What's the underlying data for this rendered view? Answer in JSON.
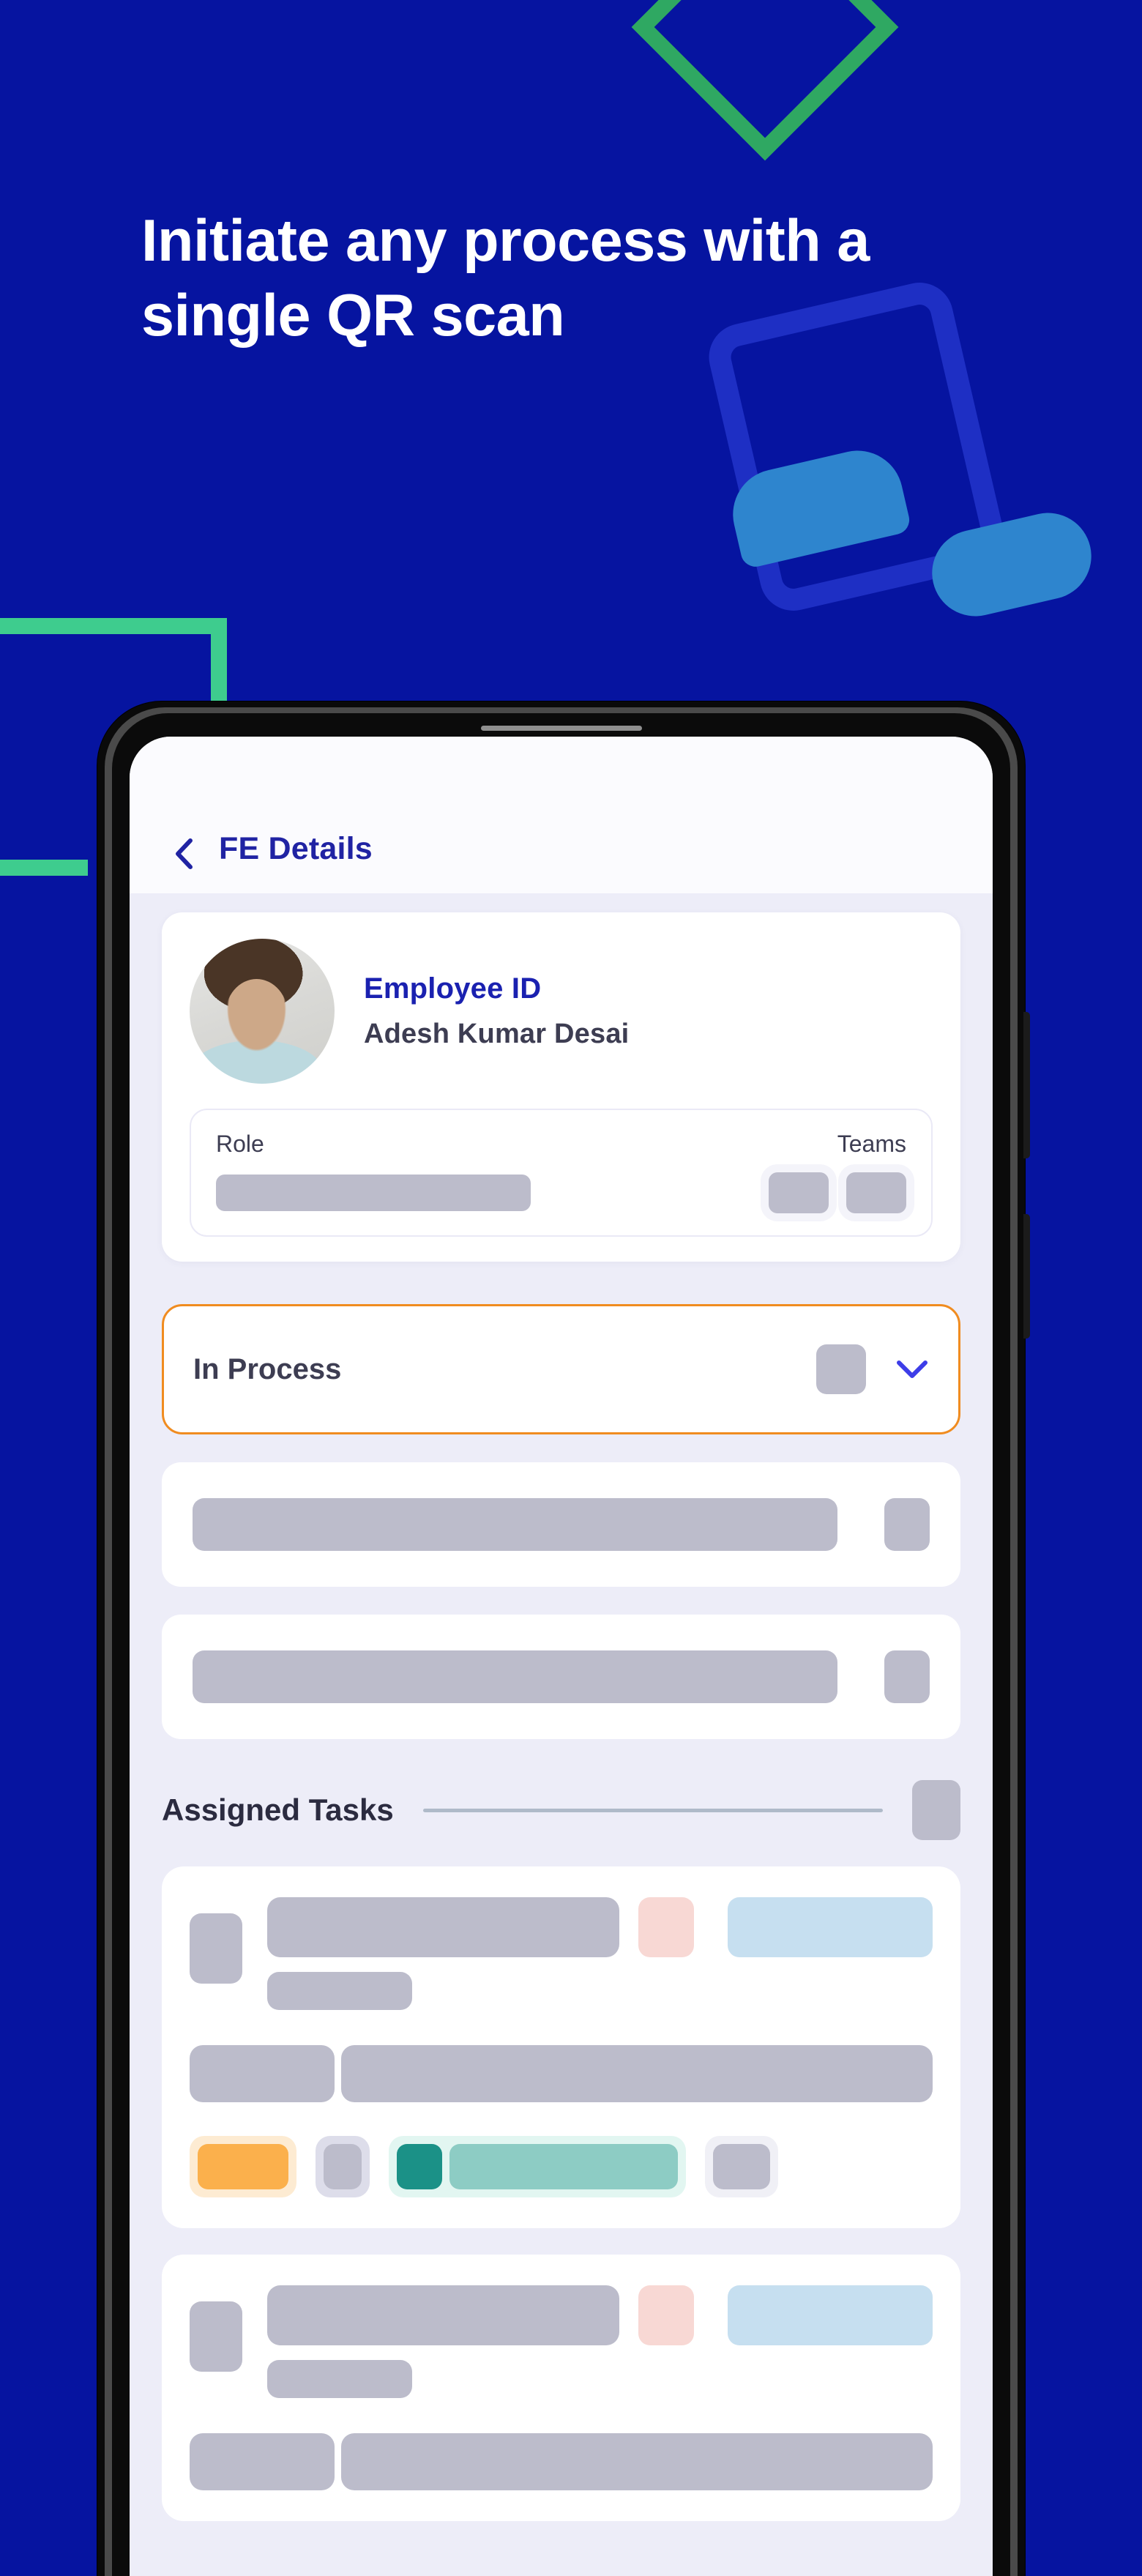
{
  "promo": {
    "headline": "Initiate any process with a single QR scan",
    "background_color": "#0614A0",
    "accent_green": "#3ECC8E",
    "accent_diamond_green": "#2FA862",
    "accent_blue_shape": "#2E85CE",
    "frame_blue": "#1E2FC4"
  },
  "phone": {
    "bezel_color": "#0a0a0a",
    "screen_background": "#EDEDF8",
    "buttons": {
      "volume": "volume-rocker",
      "power": "power-button"
    }
  },
  "app": {
    "header": {
      "back_icon": "chevron-left-icon",
      "title": "FE Details",
      "title_color": "#2023A3",
      "background": "#FBFBFE"
    },
    "employee_card": {
      "avatar": "employee-photo",
      "id_label": "Employee ID",
      "id_label_color": "#1A21B0",
      "name": "Adesh Kumar Desai",
      "name_color": "#3D3D52",
      "details": {
        "role_label": "Role",
        "teams_label": "Teams",
        "role_value_placeholder": "",
        "teams_chip_count": 2
      }
    },
    "status_select": {
      "value": "In Process",
      "border_color": "#F08C20",
      "chevron_icon": "chevron-down-icon",
      "chevron_color": "#3D3DE8",
      "trailing_chip": "status-chip-placeholder"
    },
    "skeleton_rows": [
      {
        "name": "skeleton-row-1"
      },
      {
        "name": "skeleton-row-2"
      }
    ],
    "tasks_section": {
      "title": "Assigned Tasks",
      "title_color": "#2B2B40",
      "rule_color": "#AFBAC9",
      "trailing_chip": "tasks-chip-placeholder"
    },
    "task_cards": [
      {
        "name": "task-card-1",
        "icon_placeholder": "task-icon",
        "title_placeholder": "task-title",
        "subtitle_placeholder": "task-subtitle",
        "badge_pink": "#F8D8D4",
        "badge_blue": "#C6DFF0",
        "meta_left": "task-meta-left",
        "meta_right": "task-meta-right",
        "chips": [
          {
            "name": "chip-orange",
            "fill": "#FBB04C",
            "bg": "#FDEBD2"
          },
          {
            "name": "chip-gray",
            "fill": "#BCBCCB",
            "bg": "#DDDDEA"
          },
          {
            "name": "chip-teal",
            "fill_dark": "#1B9187",
            "fill_light": "#8DCCC4",
            "bg": "#E2F6F1"
          },
          {
            "name": "chip-neutral",
            "fill": "#BCBCCB",
            "bg": "#F0F0F6"
          }
        ]
      },
      {
        "name": "task-card-2",
        "icon_placeholder": "task-icon",
        "title_placeholder": "task-title",
        "subtitle_placeholder": "task-subtitle",
        "badge_pink": "#F8D8D4",
        "badge_blue": "#C6DFF0",
        "meta_left": "task-meta-left",
        "meta_right": "task-meta-right"
      }
    ]
  }
}
